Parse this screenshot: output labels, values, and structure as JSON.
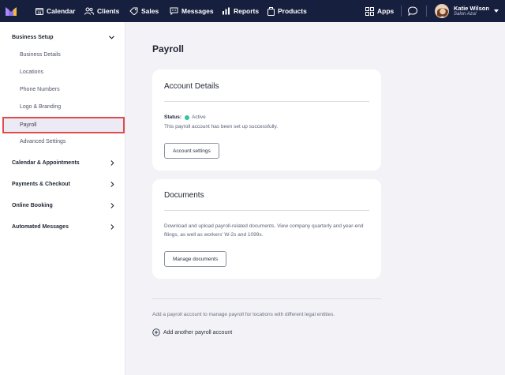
{
  "nav": {
    "items": [
      {
        "label": "Calendar",
        "icon": "calendar-icon"
      },
      {
        "label": "Clients",
        "icon": "clients-icon"
      },
      {
        "label": "Sales",
        "icon": "sales-tag-icon"
      },
      {
        "label": "Messages",
        "icon": "messages-icon"
      },
      {
        "label": "Reports",
        "icon": "reports-icon"
      },
      {
        "label": "Products",
        "icon": "products-icon"
      }
    ],
    "apps_label": "Apps",
    "user": {
      "name": "Katie Wilson",
      "salon": "Salon Azul"
    },
    "colors": {
      "bar": "#161f3d",
      "logo": "#8f6ef0"
    }
  },
  "sidebar": {
    "business_setup": "Business Setup",
    "sub_items": [
      "Business Details",
      "Locations",
      "Phone Numbers",
      "Logo & Branding",
      "Payroll",
      "Advanced Settings"
    ],
    "active": "Payroll",
    "sections": [
      "Calendar & Appointments",
      "Payments & Checkout",
      "Online Booking",
      "Automated Messages"
    ]
  },
  "main": {
    "title": "Payroll",
    "account": {
      "title": "Account Details",
      "status_label": "Status:",
      "status_value": "Active",
      "status_color": "#2ec4a4",
      "description": "This payroll account has been set up successfully.",
      "button": "Account settings"
    },
    "documents": {
      "title": "Documents",
      "description": "Download and upload payroll-related documents. View company quarterly and year-end filings, as well as workers' W-2s and 1099s.",
      "button": "Manage documents"
    },
    "note": "Add a payroll account to manage payroll for locations with different legal entities.",
    "add_link": "Add another payroll account"
  }
}
